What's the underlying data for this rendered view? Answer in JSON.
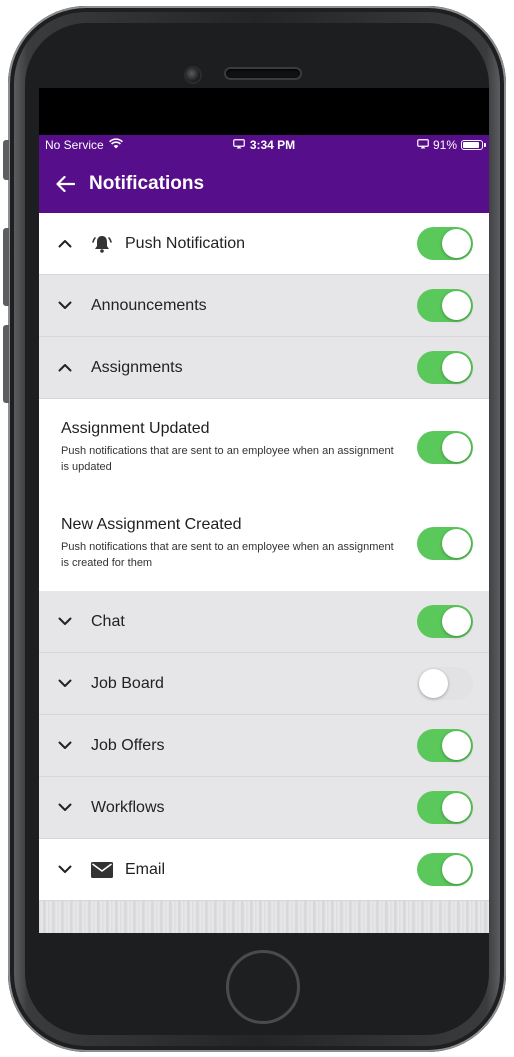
{
  "status_bar": {
    "carrier": "No Service",
    "time": "3:34 PM",
    "battery": "91%",
    "battery_level": 0.91
  },
  "header": {
    "title": "Notifications",
    "back_icon": "arrow-left-icon"
  },
  "colors": {
    "accent": "#560e8b",
    "toggle_on": "#5ac85a",
    "toggle_off": "#e2e2e4",
    "section_grey": "#e6e6e8"
  },
  "push_notification": {
    "label": "Push Notification",
    "icon": "bell-icon",
    "expanded": true,
    "enabled": true
  },
  "categories": {
    "announcements": {
      "label": "Announcements",
      "expanded": false,
      "enabled": true
    },
    "assignments": {
      "label": "Assignments",
      "expanded": true,
      "enabled": true
    },
    "chat": {
      "label": "Chat",
      "expanded": false,
      "enabled": true
    },
    "job_board": {
      "label": "Job Board",
      "expanded": false,
      "enabled": false
    },
    "job_offers": {
      "label": "Job Offers",
      "expanded": false,
      "enabled": true
    },
    "workflows": {
      "label": "Workflows",
      "expanded": false,
      "enabled": true
    }
  },
  "assignment_items": {
    "updated": {
      "title": "Assignment Updated",
      "description": "Push notifications that are sent to an employee when an assignment is updated",
      "enabled": true
    },
    "created": {
      "title": "New Assignment Created",
      "description": "Push notifications that are sent to an employee when an assignment is created for them",
      "enabled": true
    }
  },
  "email": {
    "label": "Email",
    "icon": "envelope-icon",
    "expanded": false,
    "enabled": true
  }
}
